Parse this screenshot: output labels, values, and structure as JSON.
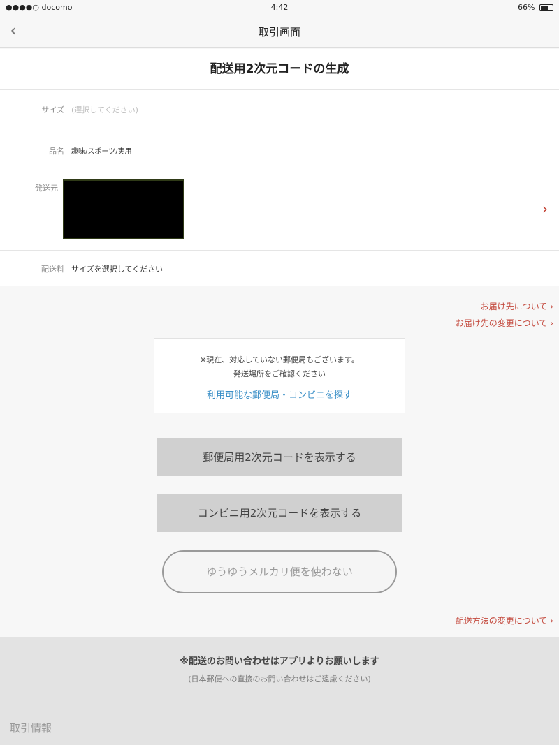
{
  "status_bar": {
    "carrier": "●●●●○ docomo",
    "time": "4:42",
    "battery": "66%"
  },
  "nav": {
    "back_icon": "‹",
    "title": "取引画面"
  },
  "card_title": "配送用2次元コードの生成",
  "fields": {
    "size_label": "サイズ",
    "size_placeholder": "(選択してください)",
    "item_label": "品名",
    "item_value": "趣味/スポーツ/実用",
    "sender_label": "発送元",
    "fee_label": "配送料",
    "fee_value": "サイズを選択してください"
  },
  "links": {
    "about_destination": "お届け先について ›",
    "change_destination": "お届け先の変更について ›",
    "change_method": "配送方法の変更について ›"
  },
  "notice": {
    "line1": "※現在、対応していない郵便局もございます。",
    "line2": "発送場所をご確認ください",
    "link": "利用可能な郵便局・コンビニを探す"
  },
  "buttons": {
    "post_office": "郵便局用2次元コードを表示する",
    "convenience": "コンビニ用2次元コードを表示する",
    "dont_use": "ゆうゆうメルカリ便を使わない"
  },
  "footer": {
    "line1": "※配送のお問い合わせはアプリよりお願いします",
    "line2": "(日本郵便への直接のお問い合わせはご遠慮ください)",
    "section": "取引情報"
  },
  "colors": {
    "accent_red": "#c44a3e",
    "link_blue": "#3a8fc7"
  }
}
